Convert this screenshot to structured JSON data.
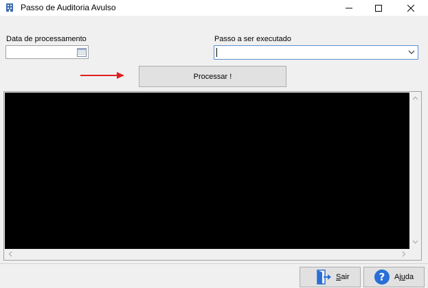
{
  "window": {
    "title": "Passo de Auditoria Avulso"
  },
  "form": {
    "date_label": "Data de processamento",
    "date_value": "",
    "step_label": "Passo a ser executado",
    "step_value": ""
  },
  "actions": {
    "process_label": "Processar !",
    "exit_label_first": "S",
    "exit_label_rest": "air",
    "help_label_first": "Aj",
    "help_label_u": "u",
    "help_label_rest": "da"
  },
  "colors": {
    "accent_border": "#5b8fd6",
    "arrow": "#e02020",
    "console_bg": "#000000",
    "help_icon": "#2a6fd6",
    "exit_icon": "#2a6fd6"
  }
}
